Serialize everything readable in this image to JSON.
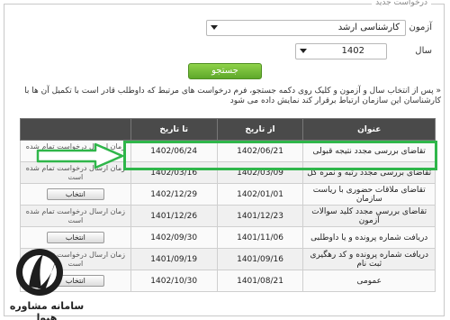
{
  "form": {
    "legend": "درخواست جدید",
    "exam_label": "آزمون",
    "exam_value": "کارشناسی ارشد",
    "year_label": "سال",
    "year_value": "1402",
    "search_label": "جستجو",
    "help_text": "« پس از انتخاب سال و آزمون و کلیک روی دکمه جستجو، فرم درخواست های مرتبط که داوطلب قادر است با تکمیل آن ها با کارشناسان این سازمان ارتباط برقرار کند نمایش داده می شود"
  },
  "table": {
    "headers": [
      "عنوان",
      "از تاریخ",
      "تا تاریخ",
      ""
    ],
    "rows": [
      {
        "title": "تقاضای بررسی مجدد نتیجه قبولی",
        "from": "1402/06/21",
        "to": "1402/06/24",
        "action": "زمان ارسال درخواست تمام شده است",
        "is_button": false
      },
      {
        "title": "تقاضای بررسی مجدد رتبه و نمره کل",
        "from": "1402/03/09",
        "to": "1402/03/16",
        "action": "زمان ارسال درخواست تمام شده است",
        "is_button": false
      },
      {
        "title": "تقاضای ملاقات حضوری با ریاست سازمان",
        "from": "1402/01/01",
        "to": "1402/12/29",
        "action": "انتخاب",
        "is_button": true
      },
      {
        "title": "تقاضای بررسی مجدد کلید سوالات آزمون",
        "from": "1401/12/23",
        "to": "1401/12/26",
        "action": "زمان ارسال درخواست تمام شده است",
        "is_button": false
      },
      {
        "title": "دریافت شماره پرونده و یا داوطلبی",
        "from": "1401/11/06",
        "to": "1402/09/30",
        "action": "انتخاب",
        "is_button": true
      },
      {
        "title": "دریافت شماره پرونده و کد رهگیری ثبت نام",
        "from": "1401/09/16",
        "to": "1401/09/19",
        "action": "زمان ارسال درخواست تمام شده است",
        "is_button": false
      },
      {
        "title": "عمومی",
        "from": "1401/08/21",
        "to": "1402/10/30",
        "action": "انتخاب",
        "is_button": true
      }
    ]
  },
  "watermark": {
    "text": "سامانه مشاوره هپوا"
  },
  "colors": {
    "highlight": "#2fb64a",
    "header_bg": "#4a4a4a",
    "search_btn": "#6cb833"
  }
}
